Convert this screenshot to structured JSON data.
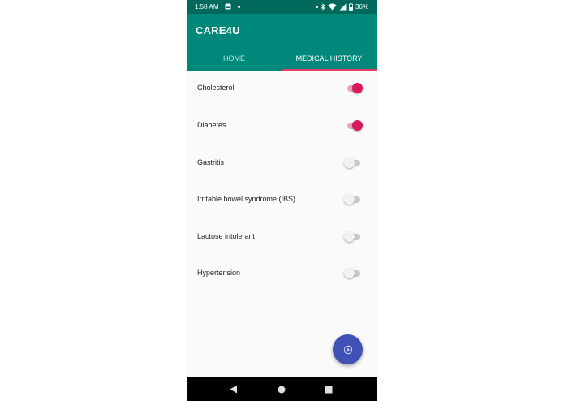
{
  "status_bar": {
    "time": "1:58 AM",
    "battery": "36%",
    "icons": [
      "image-icon",
      "dot-icon",
      "dot-icon",
      "bluetooth-icon",
      "wifi-icon",
      "signal-icon",
      "battery-icon"
    ]
  },
  "app_bar": {
    "title": "CARE4U",
    "background_color": "#00897b",
    "status_color": "#00695c"
  },
  "tabs": [
    {
      "label": "HOME",
      "active": false
    },
    {
      "label": "MEDICAL HISTORY",
      "active": true
    }
  ],
  "conditions": [
    {
      "label": "Cholesterol",
      "enabled": true
    },
    {
      "label": "Diabetes",
      "enabled": true
    },
    {
      "label": "Gastritis",
      "enabled": false
    },
    {
      "label": "Irritable bowel syndrome (IBS)",
      "enabled": false
    },
    {
      "label": "Lactose intolerant",
      "enabled": false
    },
    {
      "label": "Hypertension",
      "enabled": false
    }
  ],
  "fab": {
    "icon": "add-circle-icon",
    "color": "#3f51b5"
  },
  "switch_on_color": "#d81b60",
  "tab_indicator_color": "#e53e67",
  "nav_bar": {
    "icons": [
      "back-icon",
      "home-icon",
      "recents-icon"
    ]
  }
}
